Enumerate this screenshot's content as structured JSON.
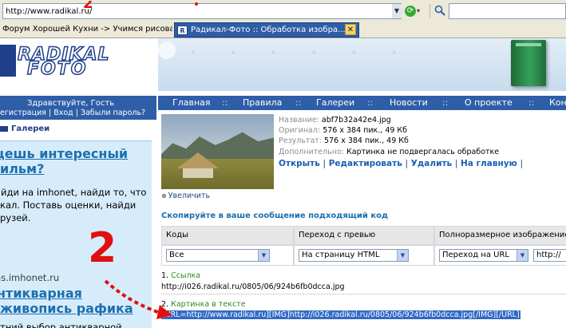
{
  "browser": {
    "address": "http://www.radikal.ru/",
    "tabs": [
      {
        "label": "Форум Хорошей Кухни -> Учимся рисова..."
      },
      {
        "label": "Радикал-Фото :: Обработка изобра..."
      }
    ],
    "tab_favicon": "R",
    "close_glyph": "✕",
    "go_glyph": "⟳"
  },
  "annotation": {
    "number": "2"
  },
  "header": {
    "logo_top": "RADIKAL",
    "logo_bottom": "FOTO"
  },
  "sidebar": {
    "greeting": "Здравствуйте, Гость",
    "auth_links": "егистрация | Вход | Забыли пароль?",
    "gallery_link": "Галереи",
    "promo": {
      "title": "щешь интересный ильм?",
      "text": "айди на imhonet, найди то, что кал. Поставь оценки, найди рузей.",
      "site": "ms.imhonet.ru"
    },
    "promo2": {
      "title": "нтикварная живопись рафика",
      "text": "тний выбор антикварной"
    }
  },
  "nav": {
    "items": [
      "Главная",
      "Правила",
      "Галереи",
      "Новости",
      "О проекте",
      "Кон"
    ],
    "separator": "::"
  },
  "image_info": {
    "name_label": "Название:",
    "name_value": "abf7b32a42e4.jpg",
    "orig_label": "Оригинал:",
    "orig_value": "576 x 384 пик., 49 Кб",
    "result_label": "Результат:",
    "result_value": "576 x 384 пик., 49 Кб",
    "extra_label": "Дополнительно:",
    "extra_value": "Картинка не подвергалась обработке",
    "actions": [
      "Открыть",
      "Редактировать",
      "Удалить",
      "На главную"
    ],
    "action_sep": "|",
    "enlarge": "Увеличить"
  },
  "copy_section": {
    "heading": "Скопируйте в ваше сообщение подходящий код",
    "columns": [
      "Коды",
      "Переход с превью",
      "Полноразмерное изображение"
    ],
    "select_codes": "Все",
    "select_preview": "На страницу HTML",
    "select_full": "Переход на URL",
    "url_field": "http://",
    "links": [
      {
        "num": "1.",
        "label": "Ссылка",
        "value": "http://i026.radikal.ru/0805/06/924b6fb0dcca.jpg"
      },
      {
        "num": "2.",
        "label": "Картинка в тексте",
        "value": "[URL=http://www.radikal.ru][IMG]http://i026.radikal.ru/0805/06/924b6fb0dcca.jpg[/IMG][/URL]"
      }
    ]
  },
  "colors": {
    "nav_blue": "#2f5ea8",
    "link_blue": "#1a5fb0",
    "annotation_red": "#e01010",
    "label_green": "#2a8a2a"
  },
  "icons": [
    "go-icon",
    "search-icon",
    "close-icon",
    "dropdown-arrow-icon",
    "magnifier-icon"
  ]
}
